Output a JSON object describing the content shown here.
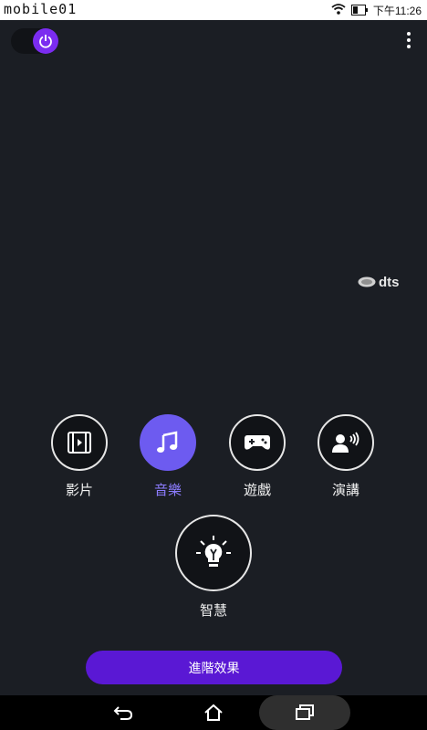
{
  "status_bar": {
    "brand": "mobile01",
    "time": "下午11:26"
  },
  "header": {
    "power_toggle": {
      "state": "on"
    },
    "menu_icon": "more-vert-icon"
  },
  "brand_logo": {
    "text": "dts"
  },
  "modes": [
    {
      "key": "movie",
      "label": "影片",
      "icon": "movie-icon",
      "active": false
    },
    {
      "key": "music",
      "label": "音樂",
      "icon": "music-note-icon",
      "active": true
    },
    {
      "key": "game",
      "label": "遊戲",
      "icon": "gamepad-icon",
      "active": false
    },
    {
      "key": "speech",
      "label": "演講",
      "icon": "speech-icon",
      "active": false
    }
  ],
  "smart_mode": {
    "label": "智慧",
    "icon": "lightbulb-icon"
  },
  "advanced_button": {
    "label": "進階效果"
  },
  "colors": {
    "background": "#1b1e24",
    "accent": "#6d5bf0",
    "button": "#5a18d4",
    "power_knob": "#7b2cf0"
  }
}
